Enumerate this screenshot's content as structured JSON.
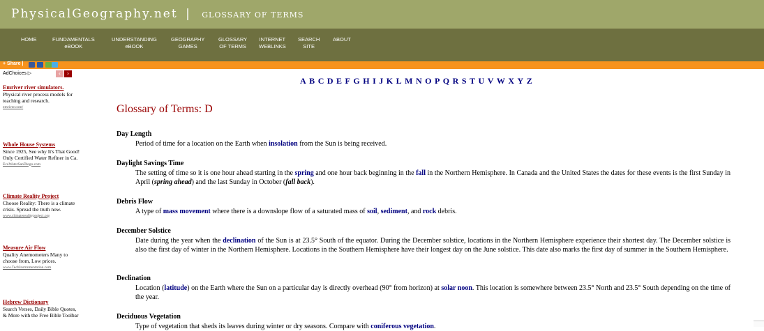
{
  "header": {
    "site": "PhysicalGeography.net",
    "separator": "|",
    "section": "GLOSSARY OF TERMS"
  },
  "nav": [
    {
      "line1": "HOME",
      "line2": ""
    },
    {
      "line1": "FUNDAMENTALS",
      "line2": "eBOOK"
    },
    {
      "line1": "UNDERSTANDING",
      "line2": "eBOOK"
    },
    {
      "line1": "GEOGRAPHY",
      "line2": "GAMES"
    },
    {
      "line1": "GLOSSARY",
      "line2": "OF TERMS"
    },
    {
      "line1": "INTERNET",
      "line2": "WEBLINKS"
    },
    {
      "line1": "SEARCH",
      "line2": "SITE"
    },
    {
      "line1": "ABOUT",
      "line2": ""
    }
  ],
  "share": {
    "label": "Share |"
  },
  "ads": {
    "adchoices": "AdChoices ▷",
    "items": [
      {
        "title": "Emriver river simulators.",
        "body": "Physical river process models for teaching and research.",
        "url": "emriver.com/"
      },
      {
        "title": "Whole House Systems",
        "body": "Since 1925, See why It's That Good! Only Certified Water Refiner in Ca.",
        "url": "EcoWaterSanDiego.com"
      },
      {
        "title": "Climate Reality Project",
        "body": "Choose Reality: There is a climate crisis. Spread the truth now.",
        "url": "www.climaterealityproject.org"
      },
      {
        "title": "Measure Air Flow",
        "body": "Quality Anemometers Many to choose from, Low prices.",
        "url": "www.TechInstrumentation.com"
      },
      {
        "title": "Hebrew Dictionary",
        "body": "Search Verses, Daily Bible Quotes, & More with the Free Bible Toolbar",
        "url": ""
      }
    ]
  },
  "alphabet": [
    "A",
    "B",
    "C",
    "D",
    "E",
    "F",
    "G",
    "H",
    "I",
    "J",
    "K",
    "L",
    "M",
    "N",
    "O",
    "P",
    "Q",
    "R",
    "S",
    "T",
    "U",
    "V",
    "W",
    "X",
    "Y",
    "Z"
  ],
  "page_title": "Glossary of Terms: D",
  "entries": {
    "day_length": {
      "term": "Day Length",
      "p1": "Period of time for a location on the Earth when ",
      "l1": "insolation",
      "p2": " from the Sun is being received."
    },
    "daylight": {
      "term": "Daylight Savings Time",
      "p1": "The setting of time so it is one hour ahead starting in the ",
      "l1": "spring",
      "p2": " and one hour back beginning in the ",
      "l2": "fall",
      "p3": " in the Northern Hemisphere. In Canada and the United States the dates for these events is the first Sunday in April (",
      "e1": "spring ahead",
      "p4": ") and the last Sunday in October (",
      "e2": "fall back",
      "p5": ")."
    },
    "debris_flow": {
      "term": "Debris Flow",
      "p1": "A type of ",
      "l1": "mass movement",
      "p2": " where there is a downslope flow of a saturated mass of ",
      "l2": "soil",
      "p3": ", ",
      "l3": "sediment",
      "p4": ", and ",
      "l4": "rock",
      "p5": " debris."
    },
    "december_solstice": {
      "term": "December Solstice",
      "p1": "Date during the year when the ",
      "l1": "declination",
      "p2": " of the Sun is at 23.5° South of the equator. During the December solstice, locations in the Northern Hemisphere experience their shortest day. The December solstice is also the first day of winter in the Northern Hemisphere. Locations in the Southern Hemisphere have their longest day on the June solstice. This date also marks the first day of summer in the Southern Hemisphere."
    },
    "declination": {
      "term": "Declination",
      "p1": "Location (",
      "l1": "latitude",
      "p2": ") on the Earth where the Sun on a particular day is directly overhead (90° from horizon) at ",
      "l2": "solar noon",
      "p3": ". This location is somewhere between 23.5° North and 23.5° South depending on the time of the year."
    },
    "deciduous": {
      "term": "Deciduous Vegetation",
      "p1": "Type of vegetation that sheds its leaves during winter or dry seasons. Compare with ",
      "l1": "coniferous vegetation",
      "p2": "."
    }
  }
}
